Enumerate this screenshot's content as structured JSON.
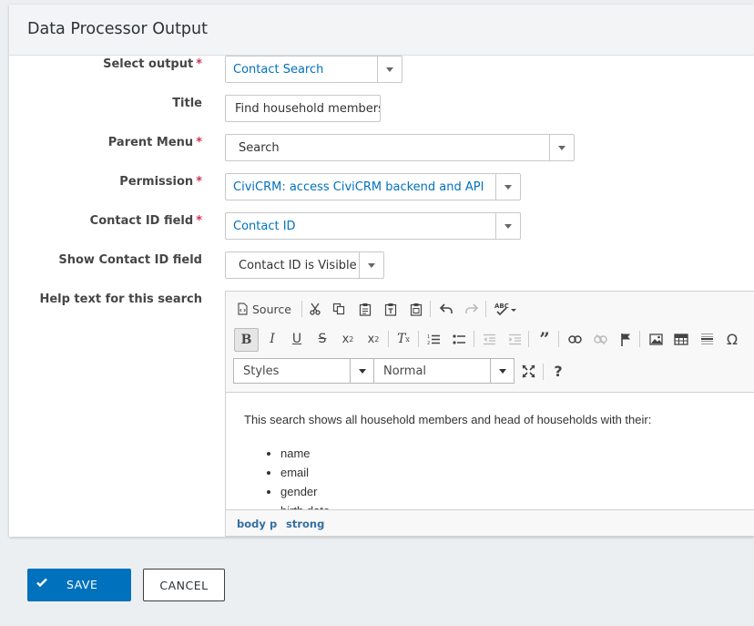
{
  "dialog": {
    "title": "Data Processor Output"
  },
  "form": {
    "select_output": {
      "label": "Select output",
      "value": "Contact Search"
    },
    "title": {
      "label": "Title",
      "value": "Find household members"
    },
    "parent_menu": {
      "label": "Parent Menu",
      "value": "Search"
    },
    "permission": {
      "label": "Permission",
      "value": "CiviCRM: access CiviCRM backend and API"
    },
    "contact_id_field": {
      "label": "Contact ID field",
      "value": "Contact ID"
    },
    "show_contact_id": {
      "label": "Show Contact ID field",
      "value": "Contact ID is Visible"
    },
    "help_text": {
      "label": "Help text for this search"
    },
    "required_marker": "*"
  },
  "editor": {
    "source_label": "Source",
    "styles_combo": "Styles",
    "format_combo": "Normal",
    "content": {
      "paragraph": "This search shows all household members and head of households with their:",
      "items": [
        "name",
        "email",
        "gender",
        "birth date"
      ]
    },
    "path": [
      "body",
      "p",
      "strong"
    ]
  },
  "buttons": {
    "save": "SAVE",
    "cancel": "CANCEL"
  },
  "colors": {
    "accent": "#0071bd",
    "required": "#cf3458"
  }
}
